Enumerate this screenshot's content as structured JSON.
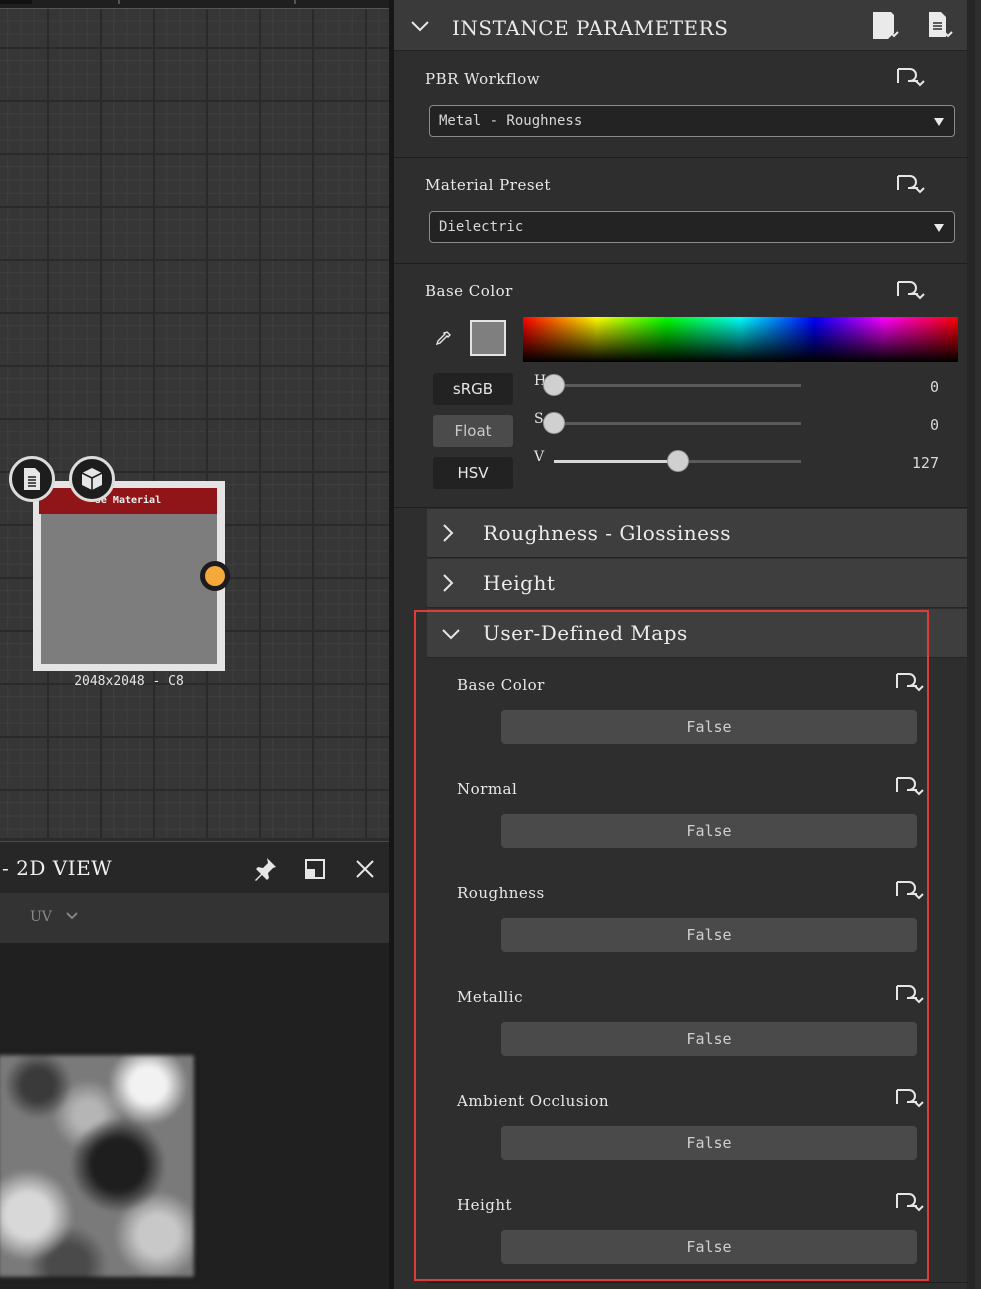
{
  "graph": {
    "node": {
      "title": "se Material",
      "resolution": "2048x2048 - C8"
    }
  },
  "view2d": {
    "title": "- 2D VIEW",
    "uv_dropdown": "UV",
    "icons": [
      "pin-icon",
      "maximize-icon",
      "close-icon"
    ]
  },
  "panel": {
    "title": "INSTANCE PARAMETERS",
    "icons": [
      "preset-icon",
      "document-icon"
    ],
    "pbr_workflow": {
      "label": "PBR Workflow",
      "value": "Metal - Roughness"
    },
    "material_preset": {
      "label": "Material Preset",
      "value": "Dielectric"
    },
    "base_color": {
      "label": "Base Color",
      "swatch": "#7f7f7f",
      "modes": [
        "sRGB",
        "Float",
        "HSV"
      ],
      "active_mode": "Float",
      "sliders": [
        {
          "label": "H",
          "value": "0",
          "fraction": 0.0
        },
        {
          "label": "S",
          "value": "0",
          "fraction": 0.0
        },
        {
          "label": "V",
          "value": "127",
          "fraction": 0.5
        }
      ]
    },
    "groups": {
      "roughness_glossiness": "Roughness - Glossiness",
      "height": "Height",
      "user_defined_maps": "User-Defined Maps"
    },
    "user_maps": [
      {
        "label": "Base Color",
        "value": "False"
      },
      {
        "label": "Normal",
        "value": "False"
      },
      {
        "label": "Roughness",
        "value": "False"
      },
      {
        "label": "Metallic",
        "value": "False"
      },
      {
        "label": "Ambient Occlusion",
        "value": "False"
      },
      {
        "label": "Height",
        "value": "False"
      }
    ]
  },
  "colors": {
    "highlight": "#e03b3b",
    "node_header": "#8f1519",
    "node_output": "#f5a93a"
  }
}
